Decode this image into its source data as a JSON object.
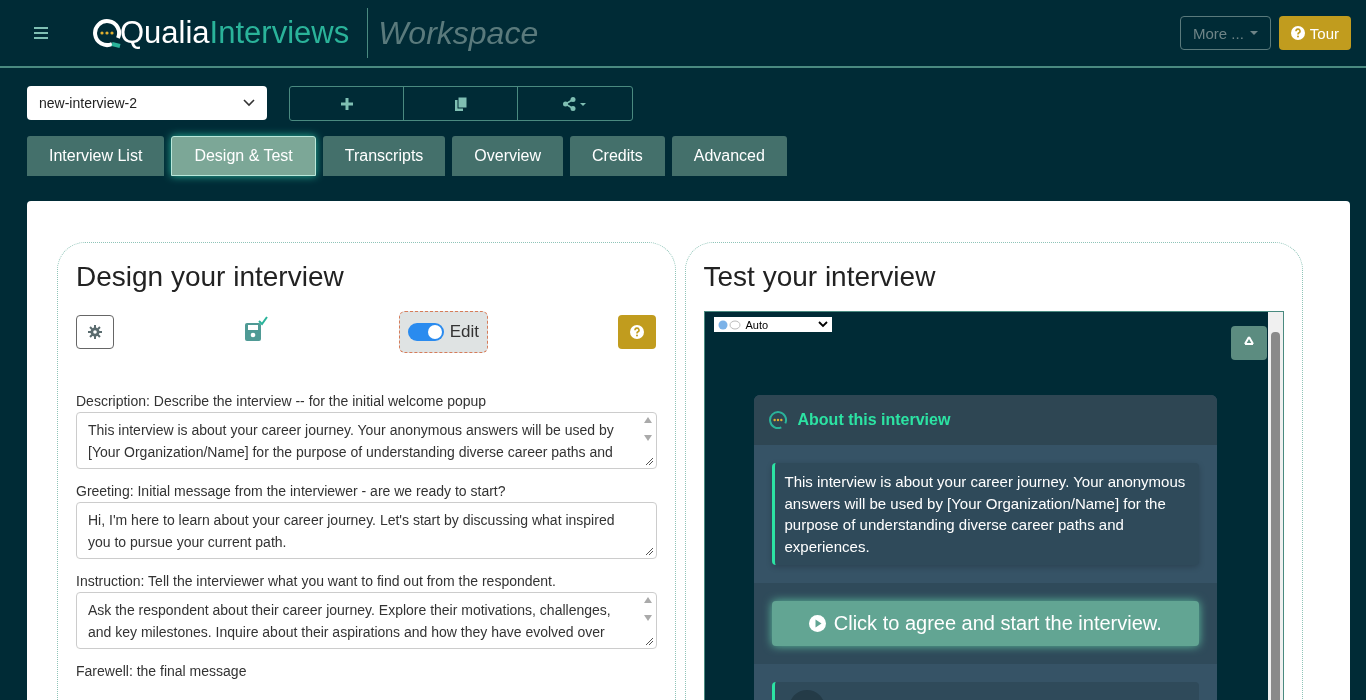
{
  "header": {
    "logo_part1": "Qualia",
    "logo_part2": "Interviews",
    "workspace": "Workspace",
    "more_button": "More ...",
    "tour_button": "Tour"
  },
  "interview_select": {
    "value": "new-interview-2"
  },
  "tabs": [
    {
      "label": "Interview List",
      "selected": false
    },
    {
      "label": "Design & Test",
      "selected": true
    },
    {
      "label": "Transcripts",
      "selected": false
    },
    {
      "label": "Overview",
      "selected": false
    },
    {
      "label": "Credits",
      "selected": false
    },
    {
      "label": "Advanced",
      "selected": false
    }
  ],
  "design": {
    "title": "Design your interview",
    "edit_toggle": {
      "label": "Edit",
      "on": true
    },
    "fields": [
      {
        "label": "Description: Describe the interview -- for the initial welcome popup",
        "value": "This interview is about your career journey. Your anonymous answers will be used by [Your Organization/Name] for the purpose of understanding diverse career paths and",
        "scrollable": true
      },
      {
        "label": "Greeting: Initial message from the interviewer - are we ready to start?",
        "value": "Hi, I'm here to learn about your career journey. Let's start by discussing what inspired you to pursue your current path.",
        "scrollable": false
      },
      {
        "label": "Instruction: Tell the interviewer what you want to find out from the respondent.",
        "value": "Ask the respondent about their career journey. Explore their motivations, challenges, and key milestones. Inquire about their aspirations and how they have evolved over",
        "scrollable": true
      },
      {
        "label": "Farewell: the final message"
      }
    ]
  },
  "test": {
    "title": "Test your interview",
    "language": "Auto",
    "popup_title": "About this interview",
    "popup_text": "This interview is about your career journey. Your anonymous answers will be used by [Your Organization/Name] for the purpose of understanding diverse career paths and experiences.",
    "start_button": "Click to agree and start the interview."
  }
}
